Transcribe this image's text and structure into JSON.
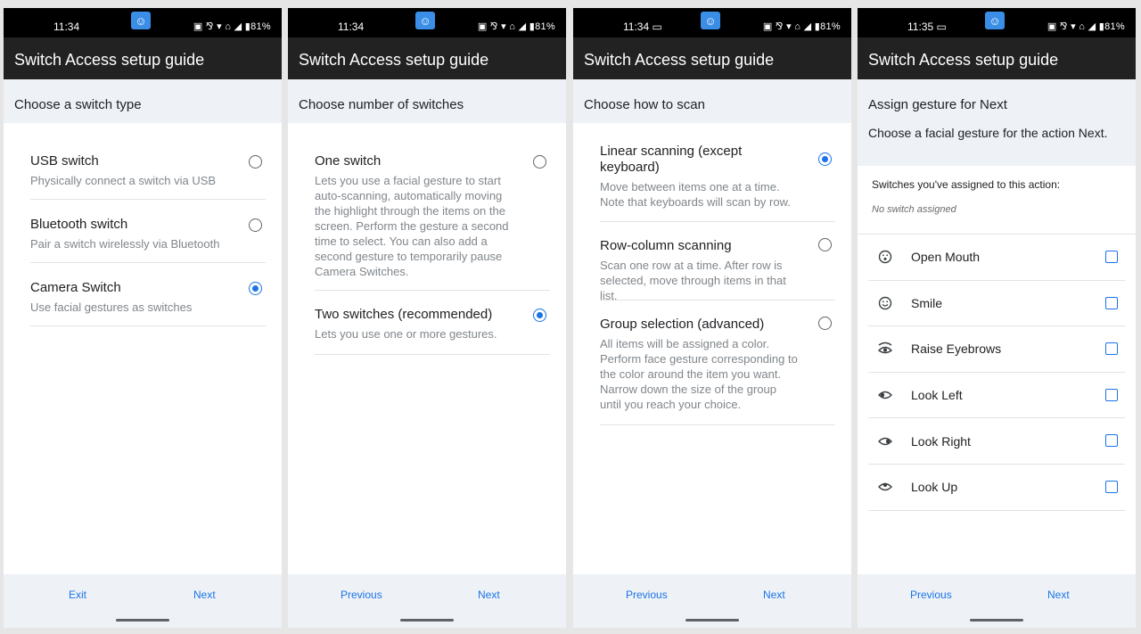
{
  "screens": [
    {
      "status": {
        "time": "11:34",
        "right": "▣ ⅋ ▾ ⌂ ◢ ▮81%"
      },
      "appbar_title": "Switch Access setup guide",
      "header": "Choose a switch type",
      "options": [
        {
          "title": "USB switch",
          "desc": "Physically connect a switch via USB",
          "checked": false
        },
        {
          "title": "Bluetooth switch",
          "desc": "Pair a switch wirelessly via Bluetooth",
          "checked": false
        },
        {
          "title": "Camera Switch",
          "desc": "Use facial gestures as switches",
          "checked": true
        }
      ],
      "nav": {
        "left": "Exit",
        "right": "Next"
      }
    },
    {
      "status": {
        "time": "11:34",
        "right": "▣ ⅋ ▾ ⌂ ◢ ▮81%"
      },
      "appbar_title": "Switch Access setup guide",
      "header": "Choose number of switches",
      "options": [
        {
          "title": "One switch",
          "desc": "Lets you use a facial gesture to start auto-scanning, automatically moving the highlight through the items on the screen. Perform the gesture a second time to select. You can also add a second gesture to temporarily pause Camera Switches.",
          "checked": false
        },
        {
          "title": "Two switches (recommended)",
          "desc": "Lets you use one or more gestures.",
          "checked": true
        }
      ],
      "nav": {
        "left": "Previous",
        "right": "Next"
      }
    },
    {
      "status": {
        "time": "11:34 ▭",
        "right": "▣ ⅋ ▾ ⌂ ◢ ▮81%"
      },
      "appbar_title": "Switch Access setup guide",
      "header": "Choose how to scan",
      "options": [
        {
          "title": "Linear scanning (except keyboard)",
          "desc": "Move between items one at a time. Note that keyboards will scan by row.",
          "checked": true
        },
        {
          "title": "Row-column scanning",
          "desc": "Scan one row at a time. After row is selected, move through items in that list.",
          "checked": false
        },
        {
          "title": "Group selection (advanced)",
          "desc": "All items will be assigned a color. Perform face gesture corresponding to the color around the item you want. Narrow down the size of the group until you reach your choice.",
          "checked": false
        }
      ],
      "nav": {
        "left": "Previous",
        "right": "Next"
      }
    },
    {
      "status": {
        "time": "11:35 ▭",
        "right": "▣ ⅋ ▾ ⌂ ◢ ▮81%"
      },
      "appbar_title": "Switch Access setup guide",
      "header": "Assign gesture for Next",
      "subtitle": "Choose a facial gesture for the action Next.",
      "assigned_label": "Switches you've assigned to this action:",
      "assigned_none": "No switch assigned",
      "gestures": [
        {
          "label": "Open Mouth",
          "icon": "open-mouth-face-icon"
        },
        {
          "label": "Smile",
          "icon": "smile-face-icon"
        },
        {
          "label": "Raise Eyebrows",
          "icon": "raise-eyebrows-icon"
        },
        {
          "label": "Look Left",
          "icon": "look-left-eye-icon"
        },
        {
          "label": "Look Right",
          "icon": "look-right-eye-icon"
        },
        {
          "label": "Look Up",
          "icon": "look-up-eye-icon"
        }
      ],
      "nav": {
        "left": "Previous",
        "right": "Next"
      }
    }
  ],
  "colors": {
    "accent": "#1a73e8",
    "appbar": "#222222",
    "header_bg": "#eef2f6"
  }
}
